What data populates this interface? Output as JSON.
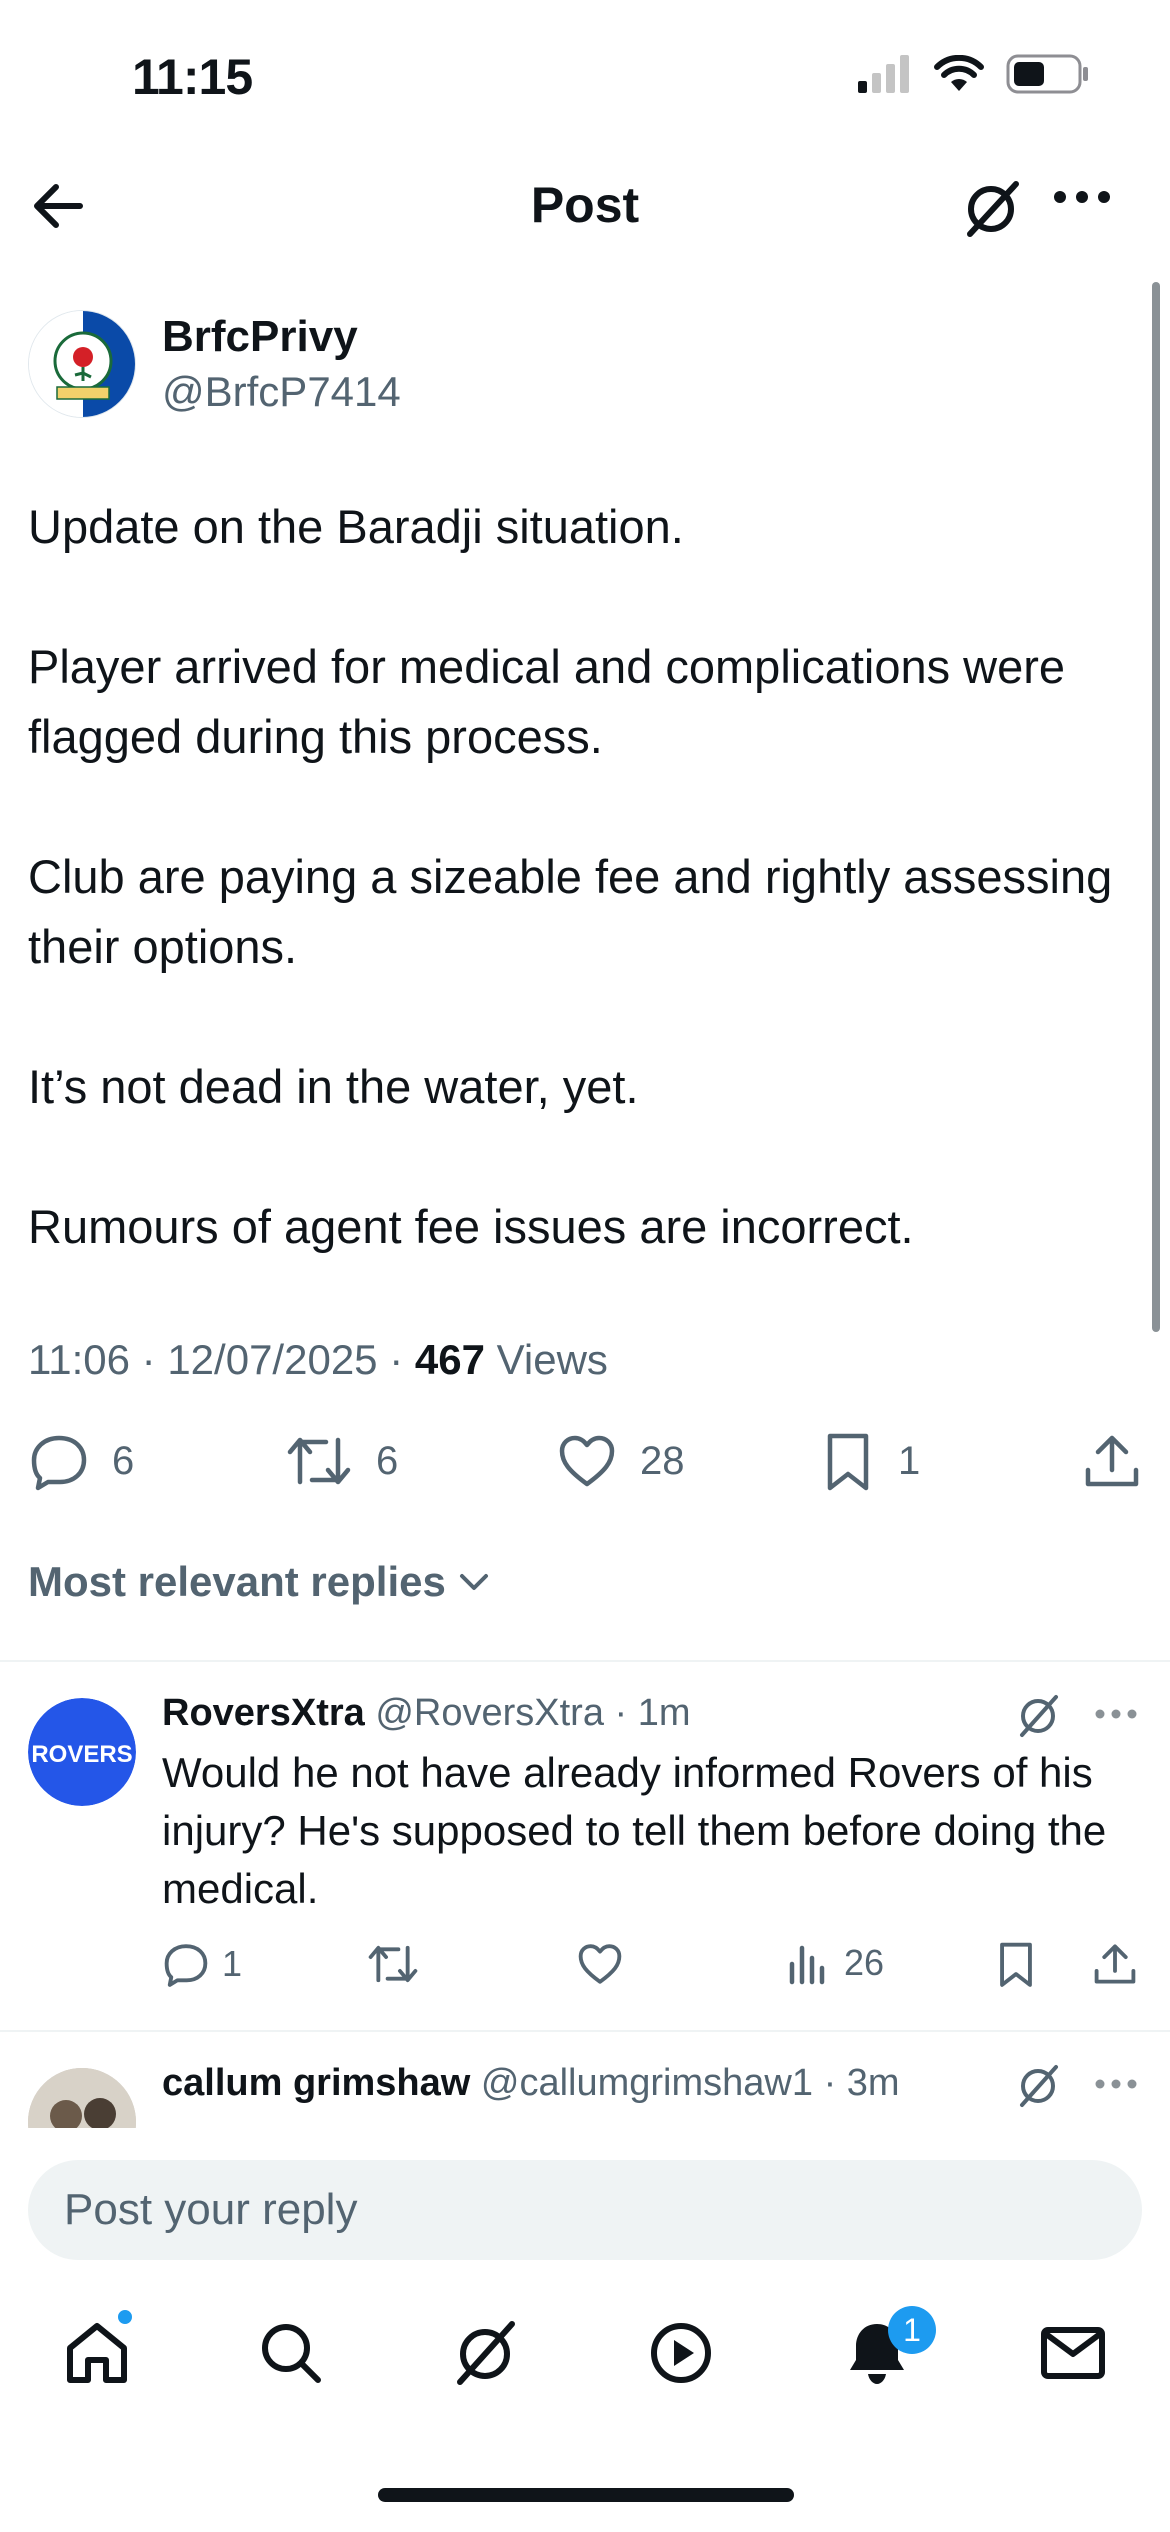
{
  "status_bar": {
    "time": "11:15"
  },
  "header": {
    "title": "Post"
  },
  "post": {
    "author_name": "BrfcPrivy",
    "author_handle": "@BrfcP7414",
    "paragraphs": [
      "Update on the Baradji situation.",
      "Player arrived for medical and complications were flagged during this process.",
      "Club are paying a sizeable fee and rightly assessing their options.",
      "It’s not dead in the water, yet.",
      "Rumours of agent fee issues are incorrect."
    ],
    "time": "11:06",
    "date": "12/07/2025",
    "views_count": "467",
    "views_label": "Views",
    "replies": "6",
    "reposts": "6",
    "likes": "28",
    "bookmarks": "1"
  },
  "replies_filter": "Most relevant replies",
  "replies": [
    {
      "name": "RoversXtra",
      "handle": "@RoversXtra",
      "age": "1m",
      "avatar_text": "ROVERS",
      "text": "Would he not have already informed Rovers of his injury? He's supposed to tell them before doing the medical.",
      "reply_count": "1",
      "views": "26"
    },
    {
      "name": "callum grimshaw",
      "handle": "@callumgrimshaw1",
      "age": "3m"
    }
  ],
  "composer": {
    "placeholder": "Post your reply"
  },
  "tab_bar": {
    "items": [
      "home-icon",
      "search-icon",
      "grok-icon",
      "video-icon",
      "notifications-icon",
      "messages-icon"
    ],
    "notifications_badge": "1"
  },
  "colors": {
    "accent": "#1d9bf0",
    "text": "#0f1419",
    "muted": "#536471"
  }
}
